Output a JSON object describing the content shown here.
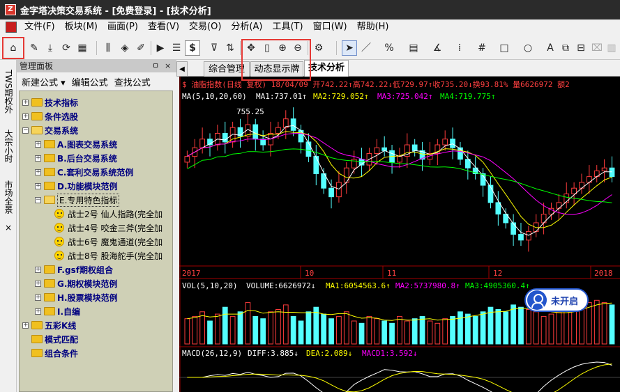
{
  "window": {
    "title": "金字塔决策交易系统 - [免费登录] - [技术分析]"
  },
  "menu": [
    "文件(F)",
    "板块(M)",
    "画面(P)",
    "查看(V)",
    "交易(O)",
    "分析(A)",
    "工具(T)",
    "窗口(W)",
    "帮助(H)"
  ],
  "panel": {
    "title": "管理面板",
    "pin": "ㅁ",
    "close": "×",
    "actions": [
      "新建公式 ▾",
      "编辑公式",
      "查找公式"
    ],
    "side_tabs": [
      "TWS期权外",
      "大宗小时",
      "市场全景"
    ],
    "side_close": "×",
    "tree": [
      {
        "label": "技术指标",
        "level": 0,
        "exp": "+",
        "bold": true
      },
      {
        "label": "条件选股",
        "level": 0,
        "exp": "+",
        "bold": true
      },
      {
        "label": "交易系统",
        "level": 0,
        "exp": "−",
        "bold": true,
        "open": true
      },
      {
        "label": "A.图表交易系统",
        "level": 1,
        "exp": "+",
        "bold": true
      },
      {
        "label": "B.后台交易系统",
        "level": 1,
        "exp": "+",
        "bold": true
      },
      {
        "label": "C.套利交易系统范例",
        "level": 1,
        "exp": "+",
        "bold": true
      },
      {
        "label": "D.功能模块范例",
        "level": 1,
        "exp": "+",
        "bold": true
      },
      {
        "label": "E.专用特色指标",
        "level": 1,
        "exp": "−",
        "bold": false,
        "open": true,
        "selected": true
      },
      {
        "label": "战士2号    仙人指路(完全加",
        "level": 2,
        "smile": true
      },
      {
        "label": "战士4号    咬金三斧(完全加",
        "level": 2,
        "smile": true
      },
      {
        "label": "战士6号    魔鬼通道(完全加",
        "level": 2,
        "smile": true
      },
      {
        "label": "战士8号    股海舵手(完全加",
        "level": 2,
        "smile": true
      },
      {
        "label": "F.gsf期权组合",
        "level": 1,
        "exp": "+",
        "bold": true
      },
      {
        "label": "G.期权模块范例",
        "level": 1,
        "exp": "+",
        "bold": true
      },
      {
        "label": "H.股票模块范例",
        "level": 1,
        "exp": "+",
        "bold": true
      },
      {
        "label": "I.自编",
        "level": 1,
        "exp": "+",
        "bold": true
      },
      {
        "label": "五彩K线",
        "level": 0,
        "exp": "+",
        "bold": true
      },
      {
        "label": "模式匹配",
        "level": 0,
        "exp": "",
        "bold": true
      },
      {
        "label": "组合条件",
        "level": 0,
        "exp": "",
        "bold": true
      }
    ]
  },
  "tabs": {
    "nav_arrow": "◀",
    "items": [
      "综合管理",
      "动态显示牌",
      "技术分析"
    ],
    "active": 2
  },
  "quote": {
    "header": "$ 油脂指数(日线 复权) 18/04/09 开742.22↑高742.22↓低729.97↑收735.20↓换93.81% 量6626972 额2",
    "ma_label": "MA(5,10,20,60)",
    "ma1": "MA1:737.01↑",
    "ma2": "MA2:729.052↑",
    "ma3": "MA3:725.042↑",
    "ma4": "MA4:719.775↑",
    "high_mark": "755.25",
    "time_labels": [
      "2017",
      "10",
      "11",
      "12",
      "2018"
    ]
  },
  "volume": {
    "label": "VOL(5,10,20)",
    "vol": "VOLUME:6626972↓",
    "ma1": "MA1:6054563.6↑",
    "ma2": "MA2:5737980.8↑",
    "ma3": "MA3:4905360.4↑"
  },
  "macd": {
    "label": "MACD(26,12,9)",
    "diff": "DIFF:3.885↓",
    "dea": "DEA:2.089↓",
    "macd": "MACD1:3.592↓"
  },
  "badge": {
    "text": "未开启"
  },
  "toolbar": {
    "dollar": "$"
  },
  "chart_data": {
    "type": "candlestick",
    "price_range": [
      705,
      760
    ],
    "title": "油脂指数(日线 复权)",
    "close": [
      742,
      745,
      748,
      746,
      750,
      747,
      752,
      749,
      753,
      748,
      746,
      750,
      752,
      755,
      751,
      747,
      742,
      736,
      731,
      728,
      733,
      738,
      741,
      739,
      743,
      745,
      744,
      740,
      742,
      746,
      744,
      741,
      743,
      746,
      748,
      745,
      741,
      738,
      736,
      732,
      726,
      722,
      719,
      715,
      713,
      716,
      719,
      722,
      724,
      726,
      729,
      731,
      733,
      735,
      737,
      738,
      735
    ],
    "volume_ratio": [
      0.55,
      0.6,
      0.7,
      0.5,
      0.65,
      0.8,
      0.6,
      0.7,
      0.9,
      0.6,
      0.55,
      0.7,
      0.75,
      0.85,
      0.6,
      0.5,
      0.7,
      0.8,
      0.65,
      0.55,
      0.6,
      0.7,
      0.5,
      0.45,
      0.6,
      0.55,
      0.5,
      0.45,
      0.6,
      0.5,
      0.55,
      0.6,
      0.5,
      0.45,
      0.55,
      0.6,
      0.7,
      0.65,
      0.6,
      0.7,
      0.8,
      0.75,
      0.7,
      0.85,
      0.8,
      0.75,
      0.7,
      0.6,
      0.65,
      0.7,
      0.75,
      0.8,
      0.85,
      0.9,
      0.95,
      0.9,
      0.85
    ]
  }
}
